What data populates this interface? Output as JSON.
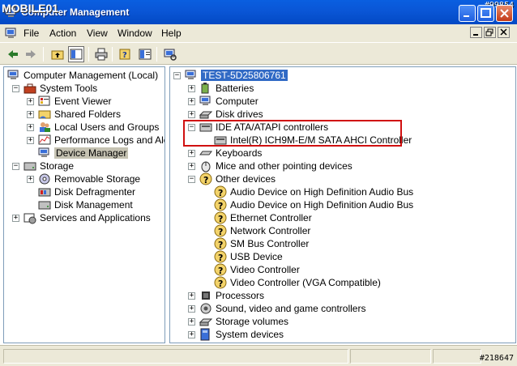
{
  "window": {
    "title": "Computer Management",
    "watermark_brand": "MOBILE01",
    "watermark_top": "#99854",
    "watermark_bottom": "#218647"
  },
  "menu": {
    "items": [
      "File",
      "Action",
      "View",
      "Window",
      "Help"
    ]
  },
  "left_tree": {
    "root": "Computer Management (Local)",
    "system_tools": "System Tools",
    "event_viewer": "Event Viewer",
    "shared_folders": "Shared Folders",
    "local_users": "Local Users and Groups",
    "perf_logs": "Performance Logs and Alerts",
    "device_manager": "Device Manager",
    "storage": "Storage",
    "removable_storage": "Removable Storage",
    "disk_defrag": "Disk Defragmenter",
    "disk_mgmt": "Disk Management",
    "services": "Services and Applications"
  },
  "right_tree": {
    "computer_name": "TEST-5D25806761",
    "batteries": "Batteries",
    "computer": "Computer",
    "disk_drives": "Disk drives",
    "ide": "IDE ATA/ATAPI controllers",
    "ide_child": "Intel(R) ICH9M-E/M SATA AHCI Controller",
    "keyboards": "Keyboards",
    "mice": "Mice and other pointing devices",
    "other_devices": "Other devices",
    "other": [
      "Audio Device on High Definition Audio Bus",
      "Audio Device on High Definition Audio Bus",
      "Ethernet Controller",
      "Network Controller",
      "SM Bus Controller",
      "USB Device",
      "Video Controller",
      "Video Controller (VGA Compatible)"
    ],
    "processors": "Processors",
    "sound": "Sound, video and game controllers",
    "storage_volumes": "Storage volumes",
    "system_devices": "System devices"
  },
  "colors": {
    "titlebar": "#0a56d6",
    "chrome": "#ece9d8",
    "highlight_box": "#d01010",
    "selected_node": "#316ac5"
  }
}
